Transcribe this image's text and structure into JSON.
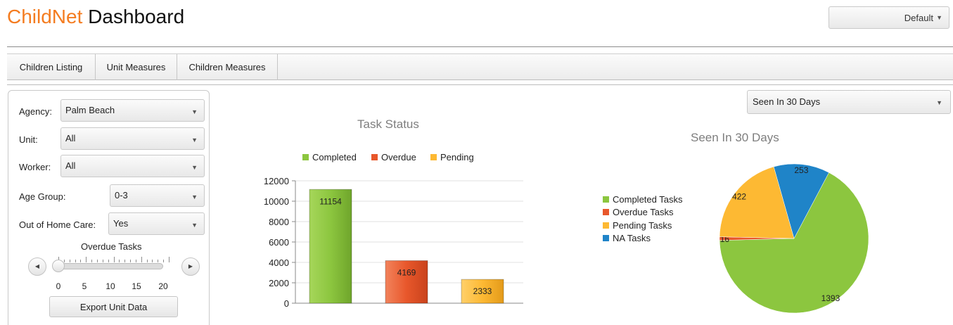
{
  "header": {
    "brand": "ChildNet",
    "title_rest": "Dashboard",
    "view_select": "Default"
  },
  "tabs": [
    {
      "label": "Children Listing"
    },
    {
      "label": "Unit Measures"
    },
    {
      "label": "Children Measures"
    }
  ],
  "filters": {
    "agency": {
      "label": "Agency:",
      "value": "Palm Beach"
    },
    "unit": {
      "label": "Unit:",
      "value": "All"
    },
    "worker": {
      "label": "Worker:",
      "value": "All"
    },
    "age_group": {
      "label": "Age Group:",
      "value": "0-3"
    },
    "out_of_home_care": {
      "label": "Out of Home Care:",
      "value": "Yes"
    },
    "overdue_slider": {
      "title": "Overdue Tasks",
      "min": 0,
      "max": 20,
      "value": 0,
      "tick_labels": [
        "0",
        "5",
        "10",
        "15",
        "20"
      ]
    },
    "export_label": "Export Unit Data"
  },
  "seen_select": "Seen In 30 Days",
  "colors": {
    "completed": "#8cc63f",
    "overdue": "#e8572b",
    "pending": "#fdb933",
    "na": "#1f84c8",
    "brand": "#f47c20"
  },
  "chart_data": [
    {
      "type": "bar",
      "title": "Task Status",
      "legend": [
        "Completed",
        "Overdue",
        "Pending"
      ],
      "legend_position": "top",
      "categories": [
        "Completed",
        "Overdue",
        "Pending"
      ],
      "values": [
        11154,
        4169,
        2333
      ],
      "ylim": [
        0,
        12000
      ],
      "yticks": [
        "12000",
        "10000",
        "8000",
        "6000",
        "4000",
        "2000",
        "0"
      ],
      "grid": true
    },
    {
      "type": "pie",
      "title": "Seen In 30 Days",
      "legend_position": "left",
      "labels": [
        "Completed Tasks",
        "Overdue Tasks",
        "Pending Tasks",
        "NA Tasks"
      ],
      "values": [
        1393,
        16,
        422,
        253
      ]
    }
  ]
}
